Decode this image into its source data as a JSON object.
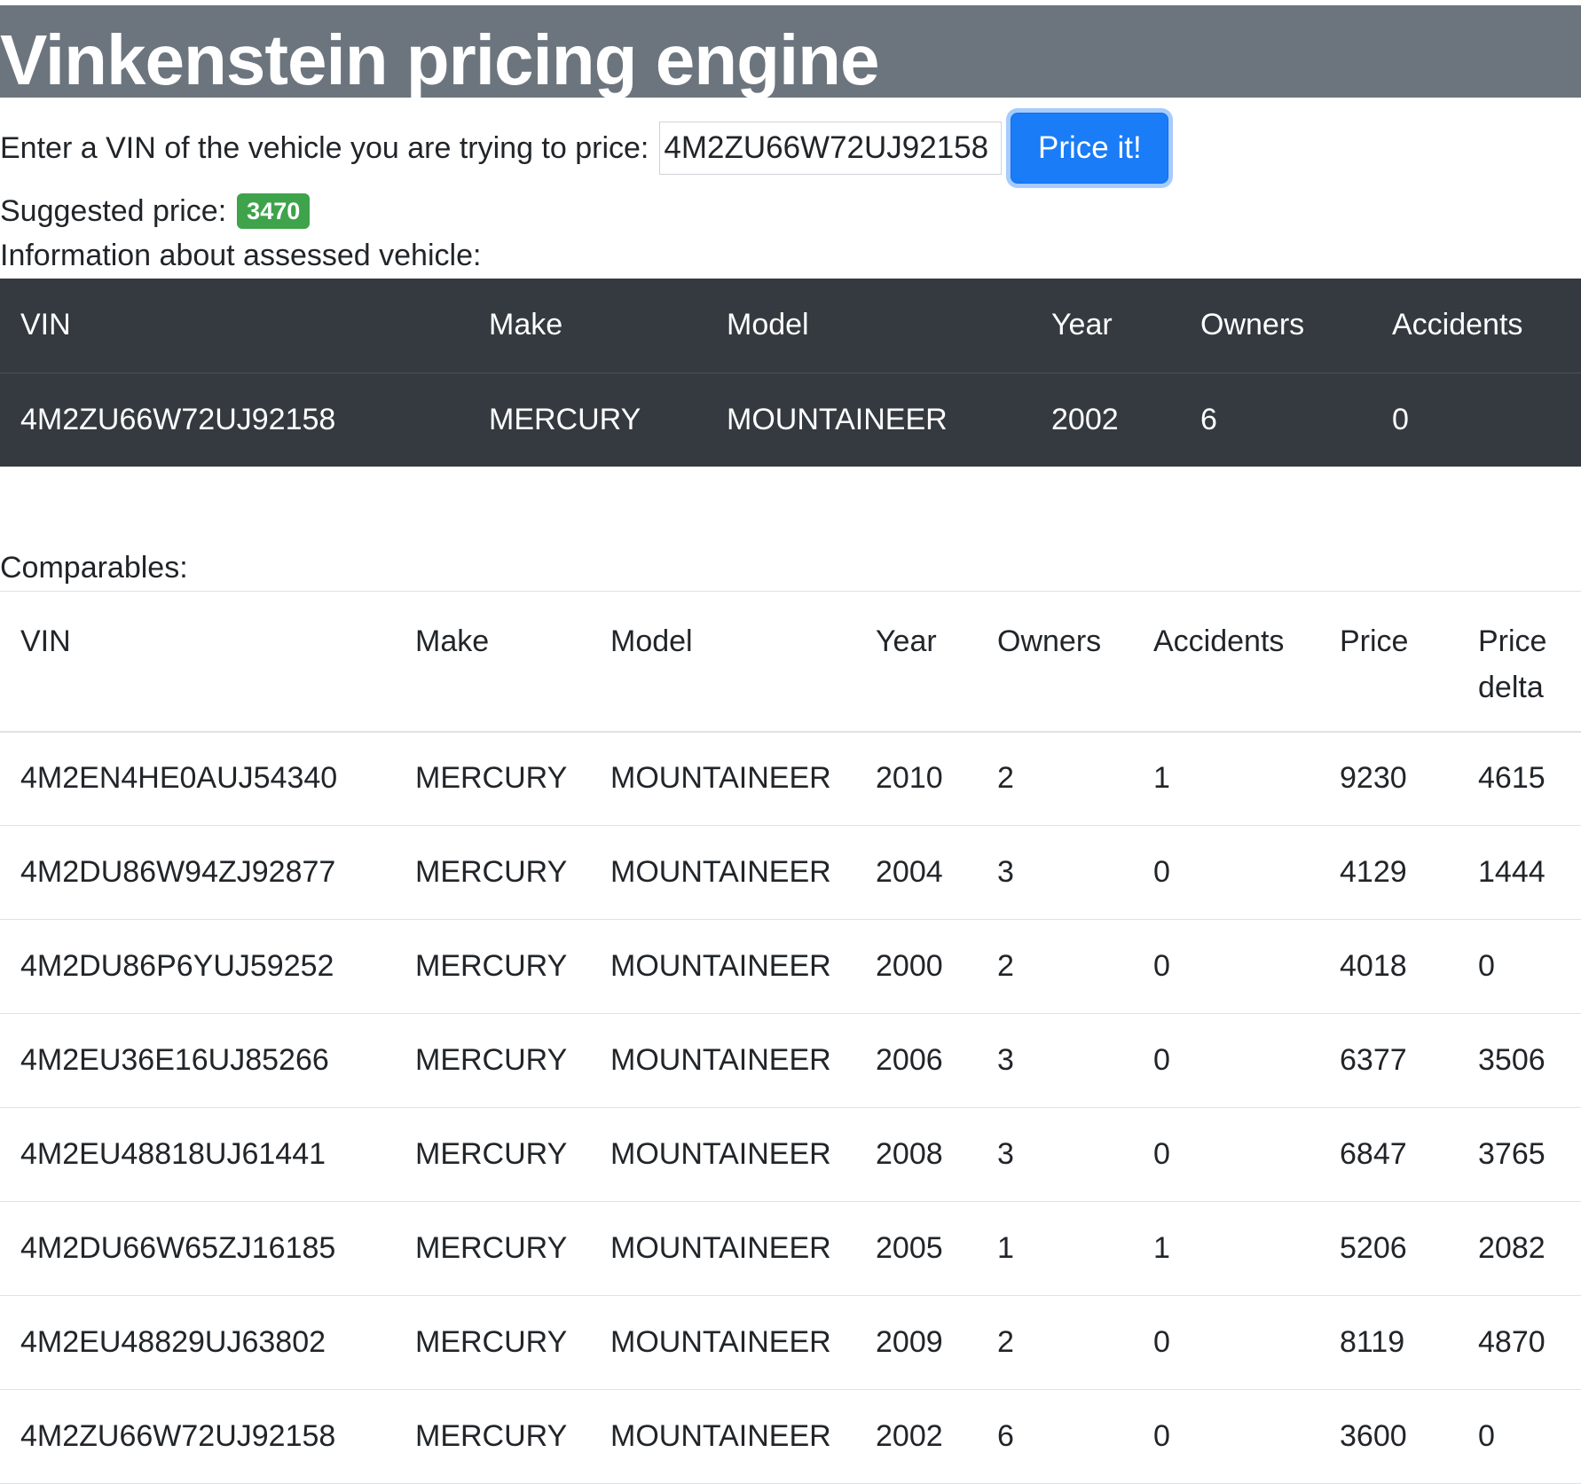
{
  "header": {
    "title": "Vinkenstein pricing engine"
  },
  "form": {
    "label": "Enter a VIN of the vehicle you are trying to price:",
    "vin_value": "4M2ZU66W72UJ92158",
    "button_label": "Price it!"
  },
  "suggested": {
    "label": "Suggested price:",
    "value": "3470"
  },
  "assessed": {
    "label": "Information about assessed vehicle:",
    "columns": [
      "VIN",
      "Make",
      "Model",
      "Year",
      "Owners",
      "Accidents"
    ],
    "row": [
      "4M2ZU66W72UJ92158",
      "MERCURY",
      "MOUNTAINEER",
      "2002",
      "6",
      "0"
    ]
  },
  "comparables": {
    "label": "Comparables:",
    "columns": [
      "VIN",
      "Make",
      "Model",
      "Year",
      "Owners",
      "Accidents",
      "Price",
      "Price delta"
    ],
    "rows": [
      [
        "4M2EN4HE0AUJ54340",
        "MERCURY",
        "MOUNTAINEER",
        "2010",
        "2",
        "1",
        "9230",
        "4615"
      ],
      [
        "4M2DU86W94ZJ92877",
        "MERCURY",
        "MOUNTAINEER",
        "2004",
        "3",
        "0",
        "4129",
        "1444"
      ],
      [
        "4M2DU86P6YUJ59252",
        "MERCURY",
        "MOUNTAINEER",
        "2000",
        "2",
        "0",
        "4018",
        "0"
      ],
      [
        "4M2EU36E16UJ85266",
        "MERCURY",
        "MOUNTAINEER",
        "2006",
        "3",
        "0",
        "6377",
        "3506"
      ],
      [
        "4M2EU48818UJ61441",
        "MERCURY",
        "MOUNTAINEER",
        "2008",
        "3",
        "0",
        "6847",
        "3765"
      ],
      [
        "4M2DU66W65ZJ16185",
        "MERCURY",
        "MOUNTAINEER",
        "2005",
        "1",
        "1",
        "5206",
        "2082"
      ],
      [
        "4M2EU48829UJ63802",
        "MERCURY",
        "MOUNTAINEER",
        "2009",
        "2",
        "0",
        "8119",
        "4870"
      ],
      [
        "4M2ZU66W72UJ92158",
        "MERCURY",
        "MOUNTAINEER",
        "2002",
        "6",
        "0",
        "3600",
        "0"
      ]
    ]
  }
}
